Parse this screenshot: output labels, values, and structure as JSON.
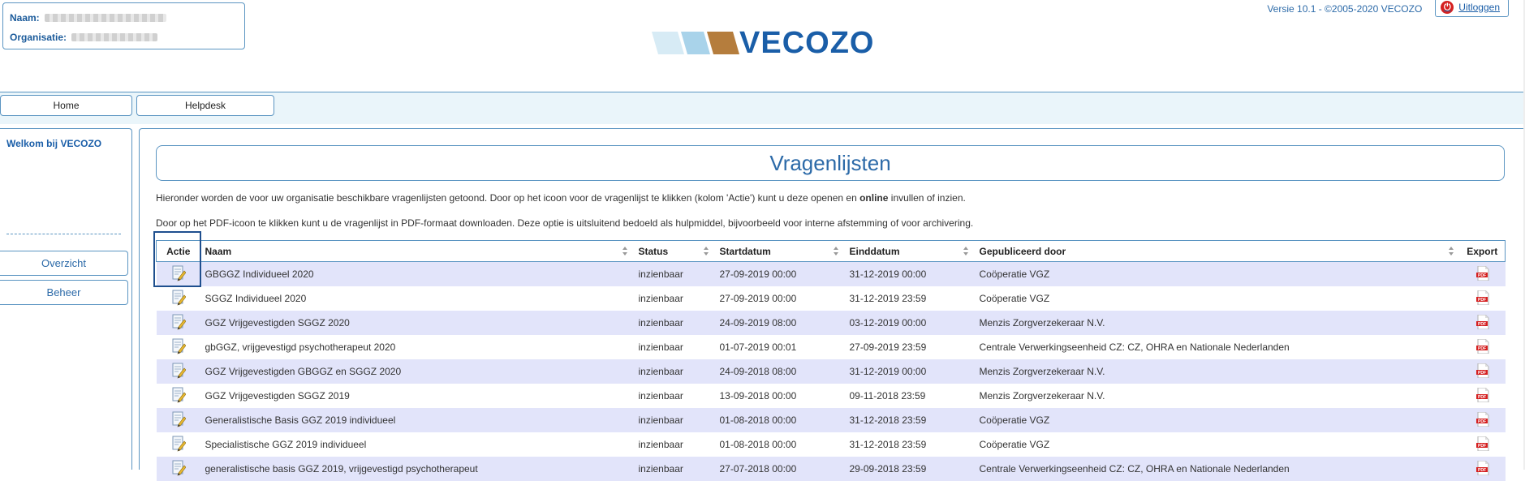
{
  "header": {
    "naam_label": "Naam:",
    "organisatie_label": "Organisatie:",
    "logo_text": "VECOZO",
    "version": "Versie 10.1 - ©2005-2020 VECOZO",
    "logout_label": "Uitloggen"
  },
  "nav": {
    "home": "Home",
    "helpdesk": "Helpdesk"
  },
  "sidebar": {
    "welcome": "Welkom bij VECOZO",
    "overzicht": "Overzicht",
    "beheer": "Beheer"
  },
  "main": {
    "title": "Vragenlijsten",
    "intro1_pre": "Hieronder worden de voor uw organisatie beschikbare vragenlijsten getoond. Door op het icoon voor de vragenlijst te klikken (kolom 'Actie') kunt u deze openen en ",
    "intro1_bold": "online",
    "intro1_post": " invullen of inzien.",
    "intro2": "Door op het PDF-icoon te klikken kunt u de vragenlijst in PDF-formaat downloaden. Deze optie is uitsluitend bedoeld als hulpmiddel, bijvoorbeeld voor interne afstemming of voor archivering."
  },
  "table": {
    "columns": [
      "Actie",
      "Naam",
      "Status",
      "Startdatum",
      "Einddatum",
      "Gepubliceerd door",
      "Export"
    ],
    "rows": [
      {
        "naam": "GBGGZ Individueel 2020",
        "status": "inzienbaar",
        "start": "27-09-2019 00:00",
        "eind": "31-12-2019 00:00",
        "door": "Coöperatie VGZ"
      },
      {
        "naam": "SGGZ Individueel 2020",
        "status": "inzienbaar",
        "start": "27-09-2019 00:00",
        "eind": "31-12-2019 23:59",
        "door": "Coöperatie VGZ"
      },
      {
        "naam": "GGZ Vrijgevestigden SGGZ 2020",
        "status": "inzienbaar",
        "start": "24-09-2019 08:00",
        "eind": "03-12-2019 00:00",
        "door": "Menzis Zorgverzekeraar N.V."
      },
      {
        "naam": "gbGGZ, vrijgevestigd psychotherapeut 2020",
        "status": "inzienbaar",
        "start": "01-07-2019 00:01",
        "eind": "27-09-2019 23:59",
        "door": "Centrale Verwerkingseenheid CZ: CZ, OHRA en Nationale Nederlanden"
      },
      {
        "naam": "GGZ Vrijgevestigden GBGGZ en SGGZ 2020",
        "status": "inzienbaar",
        "start": "24-09-2018 08:00",
        "eind": "31-12-2019 00:00",
        "door": "Menzis Zorgverzekeraar N.V."
      },
      {
        "naam": "GGZ Vrijgevestigden SGGZ 2019",
        "status": "inzienbaar",
        "start": "13-09-2018 00:00",
        "eind": "09-11-2018 23:59",
        "door": "Menzis Zorgverzekeraar N.V."
      },
      {
        "naam": "Generalistische Basis GGZ 2019 individueel",
        "status": "inzienbaar",
        "start": "01-08-2018 00:00",
        "eind": "31-12-2018 23:59",
        "door": "Coöperatie VGZ"
      },
      {
        "naam": "Specialistische GGZ 2019 individueel",
        "status": "inzienbaar",
        "start": "01-08-2018 00:00",
        "eind": "31-12-2018 23:59",
        "door": "Coöperatie VGZ"
      },
      {
        "naam": "generalistische basis GGZ 2019, vrijgevestigd psychotherapeut",
        "status": "inzienbaar",
        "start": "27-07-2018 00:00",
        "eind": "29-09-2018 23:59",
        "door": "Centrale Verwerkingseenheid CZ: CZ, OHRA en Nationale Nederlanden"
      }
    ]
  },
  "icons": {
    "edit": "edit-document-icon",
    "export": "pdf-icon",
    "logout": "power-icon"
  },
  "colors": {
    "accent": "#2c6aa8",
    "border": "#5b95c2",
    "row_alt": "#e2e4fa",
    "nav_band": "#eaf5fa",
    "logout_red": "#d52020"
  }
}
